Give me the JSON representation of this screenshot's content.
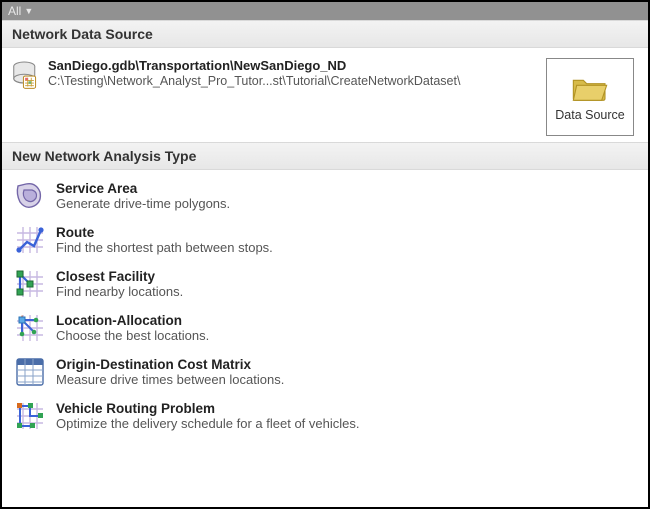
{
  "topbar": {
    "label": "All"
  },
  "sections": {
    "datasource": {
      "header": "Network Data Source",
      "title": "SanDiego.gdb\\Transportation\\NewSanDiego_ND",
      "path": "C:\\Testing\\Network_Analyst_Pro_Tutor...st\\Tutorial\\CreateNetworkDataset\\",
      "button_label": "Data Source"
    },
    "analysis": {
      "header": "New Network Analysis Type",
      "items": [
        {
          "title": "Service Area",
          "desc": "Generate drive-time polygons."
        },
        {
          "title": "Route",
          "desc": "Find the shortest path between stops."
        },
        {
          "title": "Closest Facility",
          "desc": "Find nearby locations."
        },
        {
          "title": "Location-Allocation",
          "desc": "Choose the best locations."
        },
        {
          "title": "Origin-Destination Cost Matrix",
          "desc": "Measure drive times between locations."
        },
        {
          "title": "Vehicle Routing Problem",
          "desc": "Optimize the delivery schedule for a fleet of vehicles."
        }
      ]
    }
  }
}
